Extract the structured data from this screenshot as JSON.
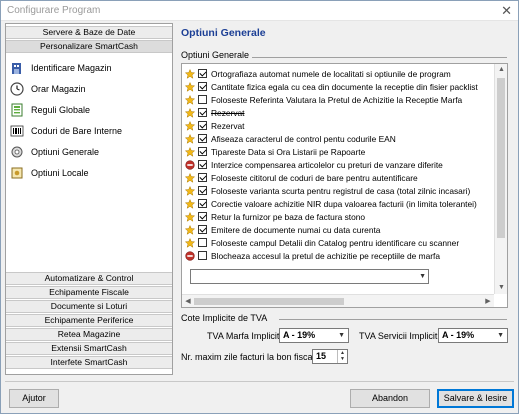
{
  "window": {
    "title": "Configurare Program",
    "close_glyph": "✕"
  },
  "left": {
    "top_sections": [
      "Servere & Baze de Date",
      "Personalizare SmartCash"
    ],
    "menu": [
      {
        "label": "Identificare Magazin",
        "icon": "store-icon"
      },
      {
        "label": "Orar Magazin",
        "icon": "clock-icon"
      },
      {
        "label": "Reguli Globale",
        "icon": "rules-icon"
      },
      {
        "label": "Coduri de Bare Interne",
        "icon": "barcode-icon"
      },
      {
        "label": "Optiuni Generale",
        "icon": "options-icon"
      },
      {
        "label": "Optiuni Locale",
        "icon": "local-options-icon"
      }
    ],
    "bottom_sections": [
      "Automatizare & Control",
      "Echipamente Fiscale",
      "Documente si Loturi",
      "Echipamente Periferice",
      "Retea Magazine",
      "Extensii SmartCash",
      "Interfete SmartCash"
    ]
  },
  "main": {
    "title": "Optiuni Generale",
    "group1_label": "Optiuni Generale",
    "options": [
      {
        "text": "Ortografiaza automat numele de localitati si optiunile de program",
        "checked": true,
        "icon": "star-icon",
        "strike": false
      },
      {
        "text": "Cantitate fizica egala cu cea din documente la receptie din fisier packlist",
        "checked": true,
        "icon": "star-icon",
        "strike": false
      },
      {
        "text": "Foloseste Referinta Valutara la Pretul de Achizitie la Receptie Marfa",
        "checked": false,
        "icon": "star-icon",
        "strike": false
      },
      {
        "text": "Rezervat",
        "checked": true,
        "icon": "star-icon",
        "strike": true
      },
      {
        "text": "Rezervat",
        "checked": true,
        "icon": "star-icon",
        "strike": false
      },
      {
        "text": "Afiseaza caracterul de control pentu codurile EAN",
        "checked": true,
        "icon": "star-icon",
        "strike": false
      },
      {
        "text": "Tipareste Data si Ora Listarii pe Rapoarte",
        "checked": true,
        "icon": "star-icon",
        "strike": false
      },
      {
        "text": "Interzice compensarea articolelor cu preturi de vanzare diferite",
        "checked": true,
        "icon": "red-circle-icon",
        "strike": false
      },
      {
        "text": "Foloseste cititorul de coduri de bare pentru autentificare",
        "checked": true,
        "icon": "star-icon",
        "strike": false
      },
      {
        "text": "Foloseste varianta scurta pentru registrul de casa (total zilnic incasari)",
        "checked": true,
        "icon": "star-icon",
        "strike": false
      },
      {
        "text": "Corectie valoare achizitie NIR dupa valoarea facturii (in limita tolerantei)",
        "checked": true,
        "icon": "star-icon",
        "strike": false
      },
      {
        "text": "Retur la furnizor pe baza de factura stono",
        "checked": true,
        "icon": "star-icon",
        "strike": false
      },
      {
        "text": "Emitere de documente numai cu data curenta",
        "checked": true,
        "icon": "star-icon",
        "strike": false
      },
      {
        "text": "Foloseste campul Detalii din Catalog pentru identificare cu scanner",
        "checked": false,
        "icon": "star-icon",
        "strike": false
      },
      {
        "text": "Blocheaza accesul la pretul de achizitie pe receptiile de marfa",
        "checked": false,
        "icon": "red-circle-icon",
        "strike": false
      }
    ],
    "dropdown_value": "",
    "group2_label": "Cote Implicite de TVA",
    "tva_marfa_label": "TVA Marfa Implicit",
    "tva_marfa_value": "A - 19%",
    "tva_servicii_label": "TVA Servicii Implicit",
    "tva_servicii_value": "A - 19%",
    "max_days_label": "Nr. maxim zile facturi la bon fiscal",
    "max_days_value": "15"
  },
  "buttons": {
    "help": "Ajutor",
    "cancel": "Abandon",
    "save": "Salvare & Iesire"
  },
  "colors": {
    "title_blue": "#1c3f95",
    "star": "#f2b818",
    "red_circle": "#c0322b"
  }
}
